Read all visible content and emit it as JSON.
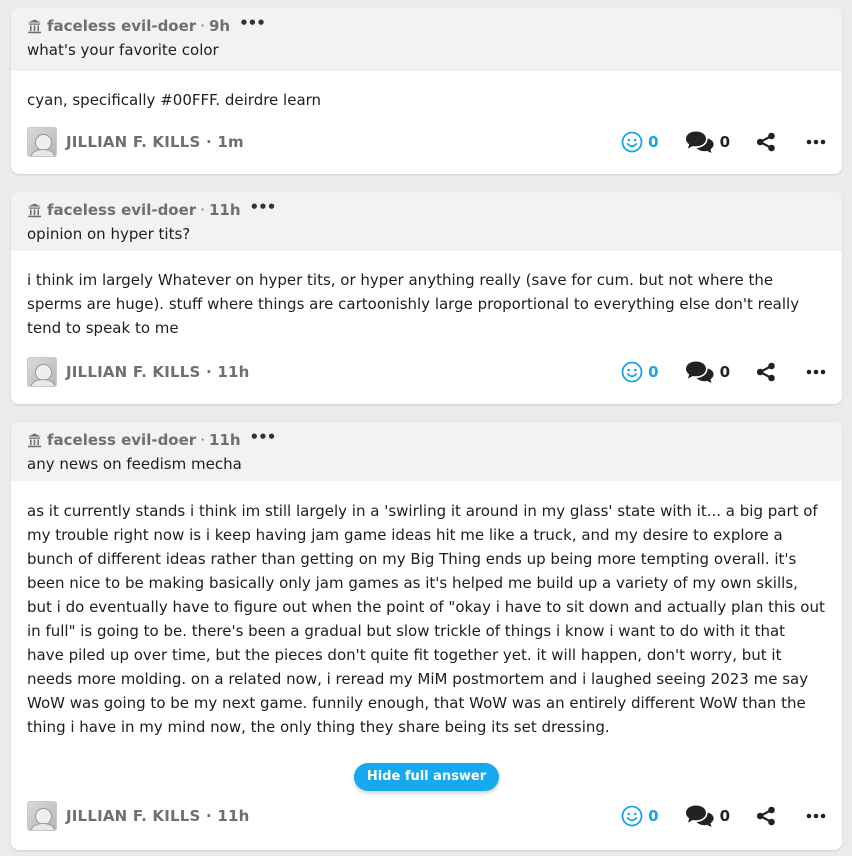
{
  "posts": [
    {
      "asker": "faceless evil-doer",
      "time": "9h",
      "question": "what's your favorite color",
      "answer": "cyan, specifically #00FFF. deirdre learn",
      "author": "JILLIAN F. KILLS",
      "author_time": "1m",
      "reactions": "0",
      "comments": "0"
    },
    {
      "asker": "faceless evil-doer",
      "time": "11h",
      "question": "opinion on hyper tits?",
      "answer": "i think im largely Whatever on hyper tits, or hyper anything really (save for cum. but not where the sperms are huge). stuff where things are cartoonishly large proportional to everything else don't really tend to speak to me",
      "author": "JILLIAN F. KILLS",
      "author_time": "11h",
      "reactions": "0",
      "comments": "0"
    },
    {
      "asker": "faceless evil-doer",
      "time": "11h",
      "question": "any news on feedism mecha",
      "answer": "as it currently stands i think im still largely in a 'swirling it around in my glass' state with it... a big part of my trouble right now is i keep having jam game ideas hit me like a truck, and my desire to explore a bunch of different ideas rather than getting on my Big Thing ends up being more tempting overall. it's been nice to be making basically only jam games as it's helped me build up a variety of my own skills, but i do eventually have to figure out when the point of \"okay i have to sit down and actually plan this out in full\" is going to be. there's been a gradual but slow trickle of things i know i want to do with it that have piled up over time, but the pieces don't quite fit together yet. it will happen, don't worry, but it needs more molding. on a related now, i reread my MiM postmortem and i laughed seeing 2023 me say WoW was going to be my next game. funnily enough, that WoW was an entirely different WoW than the thing i have in my mind now, the only thing they share being its set dressing.",
      "author": "JILLIAN F. KILLS",
      "author_time": "11h",
      "reactions": "0",
      "comments": "0",
      "hide_label": "Hide full answer"
    }
  ],
  "separator": "·",
  "more_glyph": "•••",
  "colors": {
    "accent": "#17a9ee",
    "reaction": "#1aa4e6",
    "meta": "#6f6f6f",
    "question_bg": "#f2f2f2",
    "page_bg": "#ebebeb"
  },
  "icons": {
    "asker": "shrine-icon",
    "reaction": "smiley-icon",
    "comment": "chat-bubbles-icon",
    "share": "share-icon",
    "more": "more-dots-icon"
  }
}
